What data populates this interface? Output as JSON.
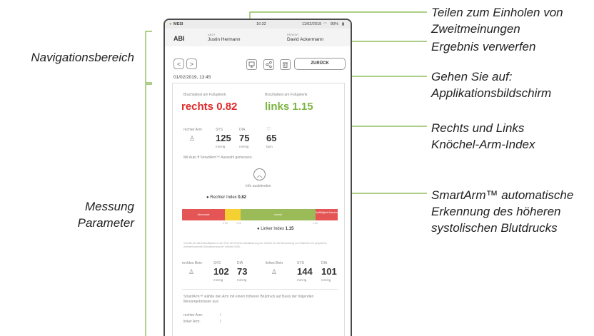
{
  "callouts": {
    "share": "Teilen zum Einholen von Zweitmeinungen",
    "discard": "Ergebnis verwerfen",
    "goto": "Gehen Sie auf: Applikationsbildschirm",
    "index": "Rechts und Links Knöchel-Arm-Index",
    "smartarm": "SmartArm™ automatische Erkennung des höheren systolischen Blutdrucks",
    "nav": "Navigationsbereich",
    "measure": "Messung Parameter"
  },
  "status": {
    "brand": "MESI",
    "time": "16:32",
    "date": "11/02/2019",
    "battery": "80%"
  },
  "header": {
    "title": "ABI",
    "doctor_label": "ARZT",
    "doctor": "Justin Hermann",
    "patient_label": "PATIENT",
    "patient": "David Ackermann"
  },
  "nav": {
    "prev": "<",
    "next": ">",
    "back_label": "ZURÜCK",
    "datetime": "01/02/2019, 13:45"
  },
  "icons": {
    "share_a": "monitor-share-icon",
    "share_b": "share-icon",
    "discard": "trash-icon"
  },
  "result": {
    "right_label": "Brachialtest am Fußgelenk",
    "right_value": "rechts 0.82",
    "left_label": "Brachialtest am Fußgelenk",
    "left_value": "links 1.15",
    "color_right": "#e02a2a",
    "color_left": "#7bb441"
  },
  "arm": {
    "label": "rechter Arm",
    "sys_label": "SYS",
    "sys": "125",
    "sys_unit": "mmHg",
    "dia_label": "DIA",
    "dia": "75",
    "dia_unit": "mmHg",
    "pulse": "65",
    "pulse_unit": "bpm",
    "note": "Mit Auto ff SmartArm™ Auswahl gemessen.",
    "hide_info": "Info ausblenden"
  },
  "scale": {
    "right_index_label": "Rechter Index",
    "right_index": "0.82",
    "left_index_label": "Linker Index",
    "left_index": "1.15",
    "seg_red": "Abnormale",
    "seg_green": "normal",
    "seg_right": "Auffälligkeit Arterien",
    "tick_a": "0.90",
    "tick_b": "1.00",
    "tick_c": "1.40"
  },
  "guideline": "Gemäß der ABI-Klassifikation in der 2011 ACCF/AHA-Aktualisierung der Leitlinie für die Behandlung von Patienten mit peripheren Arterienkrankheit (Aktualisierung der Leitlinie 2005)",
  "legs": {
    "right_label": "rechtes Bein",
    "right_sys": "102",
    "right_dia": "73",
    "left_label": "linkes Bein",
    "left_sys": "144",
    "left_dia": "101",
    "sys_label": "SYS",
    "dia_label": "DIA",
    "unit": "mmHg"
  },
  "smartarm": {
    "text": "SmartArm™ wählte den Arm mit einem höheren Blutdruck auf Basis der folgenden Messergebnissen aus:",
    "right_arm": "rechter Arm:",
    "right_arm_val": "/",
    "left_arm": "linker Arm:",
    "left_arm_val": "/"
  }
}
